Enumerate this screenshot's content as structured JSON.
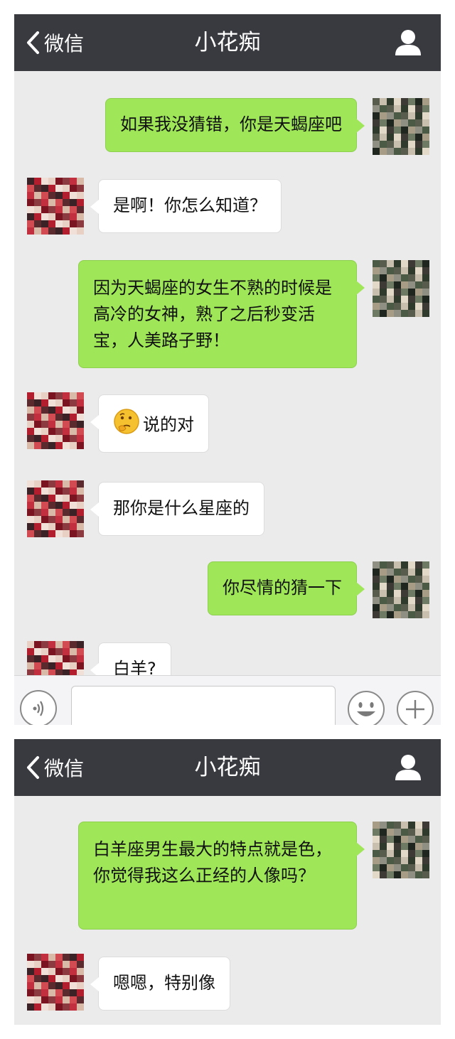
{
  "contact_name": "小花痴",
  "back_label": "微信",
  "colors": {
    "navbar": "#393a3f",
    "chat_bg": "#ebebeb",
    "my_bubble": "#9fe658",
    "their_bubble": "#ffffff"
  },
  "screen1": {
    "messages": [
      {
        "sender": "me",
        "text": "如果我没猜错，你是天蝎座吧"
      },
      {
        "sender": "them",
        "text": "是啊！你怎么知道？"
      },
      {
        "sender": "me",
        "text": "因为天蝎座的女生不熟的时候是高冷的女神，熟了之后秒变活宝，人美路子野！"
      },
      {
        "sender": "them",
        "emoji": "thinking-face-emoji",
        "text": "说的对"
      },
      {
        "sender": "them",
        "text": "那你是什么星座的"
      },
      {
        "sender": "me",
        "text": "你尽情的猜一下"
      },
      {
        "sender": "them",
        "text": "白羊?"
      }
    ],
    "input_bar": {
      "icons": [
        "voice-icon",
        "emoji-icon",
        "plus-icon"
      ]
    }
  },
  "screen2": {
    "messages": [
      {
        "sender": "me",
        "text": "白羊座男生最大的特点就是色，你觉得我这么正经的人像吗？"
      },
      {
        "sender": "them",
        "text": "嗯嗯，特别像"
      }
    ]
  }
}
